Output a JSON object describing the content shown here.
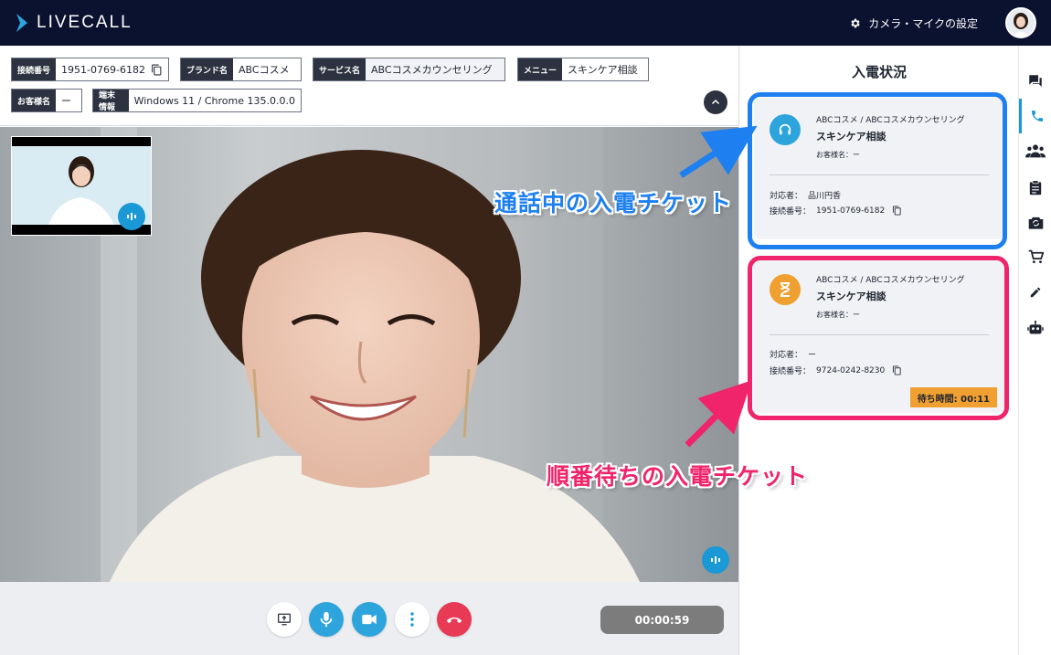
{
  "app": {
    "brand": "LIVECALL"
  },
  "header": {
    "settings_label": "カメラ・マイクの設定"
  },
  "info": {
    "connection_key": "接続番号",
    "connection_value": "1951-0769-6182",
    "brand_key": "ブランド名",
    "brand_value": "ABCコスメ",
    "service_key": "サービス名",
    "service_value": "ABCコスメカウンセリング",
    "menu_key": "メニュー",
    "menu_value": "スキンケア相談",
    "customer_key": "お客様名",
    "customer_value": "ー",
    "device_key": "端末情報",
    "device_value": "Windows 11 / Chrome 135.0.0.0"
  },
  "controls": {
    "timer": "00:00:59"
  },
  "panel": {
    "title": "入電状況",
    "tickets": [
      {
        "service": "ABCコスメ / ABCコスメカウンセリング",
        "menu": "スキンケア相談",
        "customer": "お客様名：ー",
        "agent_key": "対応者：",
        "agent_value": "品川円香",
        "conn_key": "接続番号：",
        "conn_value": "1951-0769-6182",
        "color": "#2ea4dc"
      },
      {
        "service": "ABCコスメ / ABCコスメカウンセリング",
        "menu": "スキンケア相談",
        "customer": "お客様名：ー",
        "agent_key": "対応者：",
        "agent_value": "ー",
        "conn_key": "接続番号：",
        "conn_value": "9724-0242-8230",
        "wait": "待ち時間: 00:11",
        "color": "#f0a030"
      }
    ]
  },
  "annotations": {
    "active_label": "通話中の入電チケット",
    "waiting_label": "順番待ちの入電チケット",
    "active_color": "#1e80f0",
    "waiting_color": "#f0246a"
  },
  "rail": {
    "icons": [
      "chat-icon",
      "phone-icon",
      "group-icon",
      "clipboard-icon",
      "camera-switch-icon",
      "cart-icon",
      "pencil-icon",
      "robot-icon"
    ],
    "active": "phone-icon"
  }
}
